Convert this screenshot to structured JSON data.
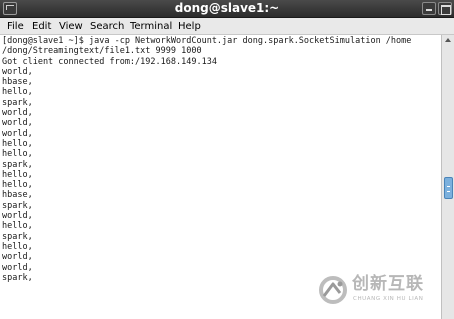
{
  "window": {
    "title": "dong@slave1:~",
    "icon": "terminal-icon",
    "controls": [
      "minimize-icon",
      "maximize-icon"
    ]
  },
  "menu": [
    "File",
    "Edit",
    "View",
    "Search",
    "Terminal",
    "Help"
  ],
  "terminal": {
    "lines": [
      "[dong@slave1 ~]$ java -cp NetworkWordCount.jar dong.spark.SocketSimulation /home",
      "/dong/Streamingtext/file1.txt 9999 1000",
      "Got client connected from:/192.168.149.134",
      "world,",
      "hbase,",
      "hello,",
      "spark,",
      "world,",
      "world,",
      "world,",
      "hello,",
      "hello,",
      "spark,",
      "hello,",
      "hello,",
      "hbase,",
      "spark,",
      "world,",
      "hello,",
      "spark,",
      "hello,",
      "world,",
      "world,",
      "spark,"
    ]
  },
  "watermark": {
    "name_cn": "创新互联",
    "name_en": "CHUANG XIN HU LIAN"
  },
  "colors": {
    "titlebar": "#2b2b2b",
    "menubar": "#e9e9e9",
    "terminal_bg": "#ffffff",
    "terminal_fg": "#1a1a1a",
    "scroll_thumb": "#7bb0dd"
  }
}
